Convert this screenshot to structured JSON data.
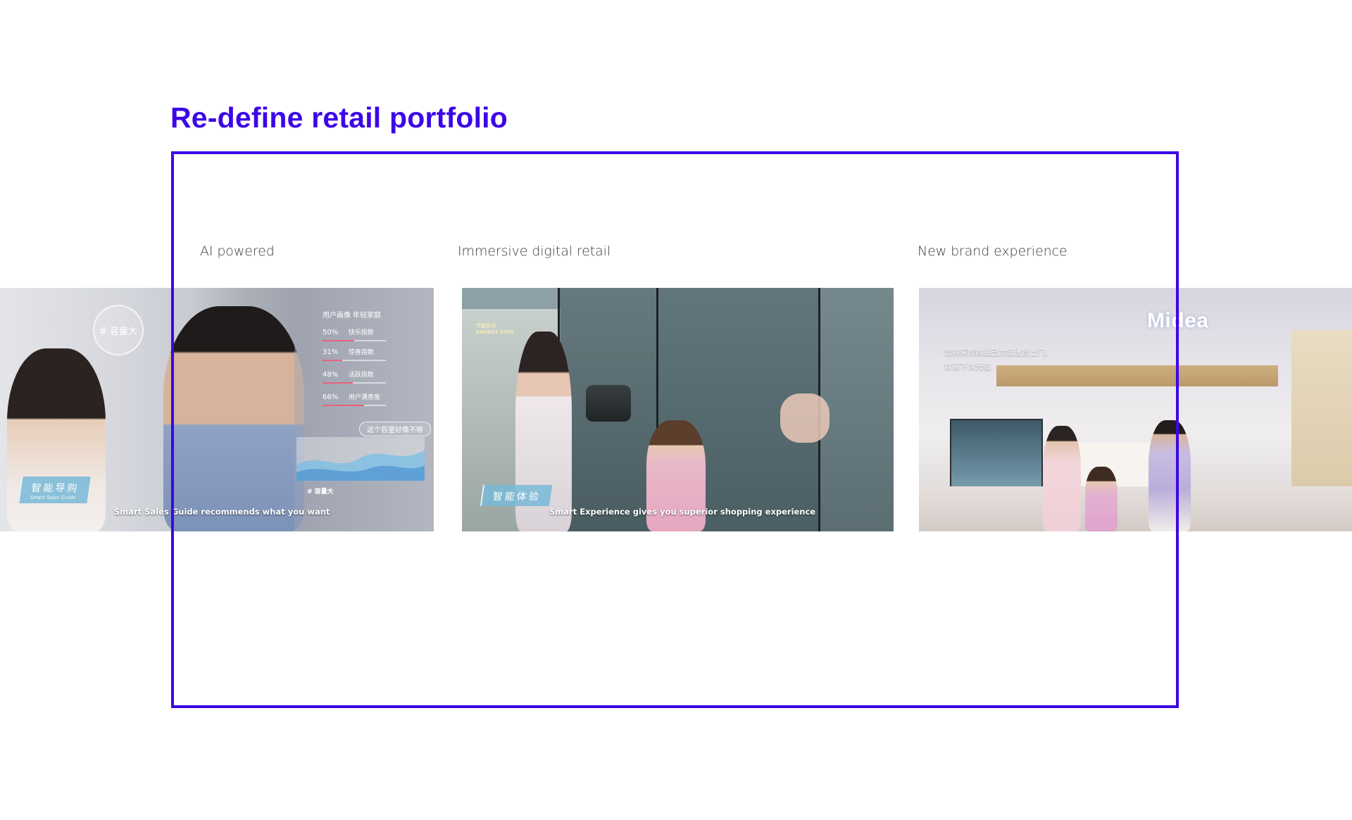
{
  "title": "Re-define retail portfolio",
  "accent_color": "#3d06e8",
  "sections": [
    {
      "label": "AI powered",
      "image": {
        "caption_cn": "智能导购",
        "caption_en": "Smart Sales Guide",
        "subtitle": "Smart Sales Guide recommends what you want",
        "hud": {
          "circle_tag": "# 容量大",
          "heading": "用户画像  年轻家庭",
          "rows": [
            {
              "pct": "50%",
              "name": "快乐指数",
              "value": 0.5
            },
            {
              "pct": "31%",
              "name": "惊喜指数",
              "value": 0.31
            },
            {
              "pct": "48%",
              "name": "活跃指数",
              "value": 0.48
            },
            {
              "pct": "66%",
              "name": "用户满意度",
              "value": 0.66
            }
          ],
          "chat_bubble": "这个容量好像不够",
          "chart_label": "# 容量大"
        }
      }
    },
    {
      "label": "Immersive digital retail",
      "image": {
        "caption_cn": "智能体验",
        "subtitle": "Smart Experience gives you superior shopping experience",
        "sign_line_1": "节能系列",
        "sign_line_2": "ENERGY STAR"
      }
    },
    {
      "label": "New brand experience",
      "image": {
        "brand": "Midea",
        "notice_line_1": "您购买的商品已为您送货上门,",
        "notice_line_2": "欢迎下次光临"
      }
    }
  ]
}
